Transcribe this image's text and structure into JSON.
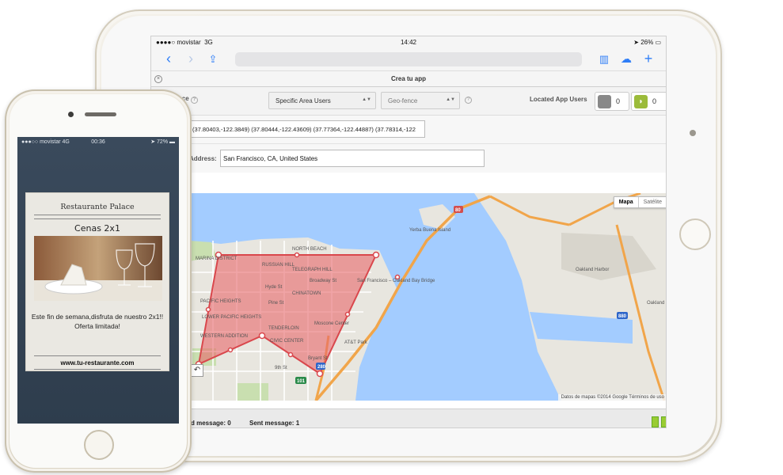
{
  "ipad": {
    "status": {
      "carrier": "movistar",
      "network": "3G",
      "time": "14:42",
      "battery": "26%"
    },
    "tab_title": "Crea tu app",
    "audience_label": "on Audience",
    "area_select": "Specific Area Users",
    "geo_select": "Geo-fence",
    "located_label": "Located App Users",
    "ios_count": "0",
    "android_count": "0",
    "coords": "(37.80403,-122.3849) (37.80444,-122.43609) (37.77364,-122.44887) (37.78314,-122",
    "address_label": "Address:",
    "address_value": "San Francisco, CA, United States",
    "map": {
      "type_map": "Mapa",
      "type_sat": "Satélite",
      "attribution": "Datos de mapas ©2014 Google     Términos de uso",
      "labels": {
        "north_beach": "NORTH BEACH",
        "marina": "MARINA DISTRICT",
        "russian_hill": "RUSSIAN HILL",
        "telegraph": "TELEGRAPH HILL",
        "broadway": "Broadway St",
        "chinatown": "CHINATOWN",
        "pacific_heights": "PACIFIC HEIGHTS",
        "lower_pacific": "LOWER PACIFIC HEIGHTS",
        "tenderloin": "TENDERLOIN",
        "civic_center": "CIVIC CENTER",
        "western_addition": "WESTERN ADDITION",
        "moscone": "Moscone Center",
        "att_park": "AT&T Park",
        "bay_bridge": "San Francisco – Oakland Bay Bridge",
        "yerba_buena": "Yerba Buena Island",
        "oakland": "Oakland",
        "oakland_harbor": "Oakland Harbor",
        "pine": "Pine St",
        "ninth": "9th St",
        "bryant": "Bryant St",
        "hyde": "Hyde St",
        "i80": "80",
        "i280": "280",
        "us101": "101",
        "i880": "880"
      }
    },
    "footer": {
      "received": "d message: 0",
      "sent": "Sent message: 1"
    }
  },
  "iphone": {
    "status": {
      "carrier": "movistar",
      "network": "4G",
      "time": "00:36",
      "battery": "72%"
    },
    "card": {
      "name": "Restaurante Palace",
      "offer": "Cenas 2x1",
      "description": "Este fin de semana,disfruta de nuestro 2x1!! Oferta limitada!",
      "url": "www.tu-restaurante.com"
    }
  },
  "colors": {
    "polygon_fill": "#e8676b",
    "water": "#a3ccff",
    "land": "#e8e6df",
    "highway": "#f1a54a",
    "ios_bg": "#888888",
    "android_bg": "#9bbb3a"
  },
  "icons": [
    "back-icon",
    "forward-icon",
    "share-icon",
    "bookmarks-icon",
    "cloud-icon",
    "add-tab-icon",
    "apple-icon",
    "android-icon",
    "undo-icon"
  ]
}
